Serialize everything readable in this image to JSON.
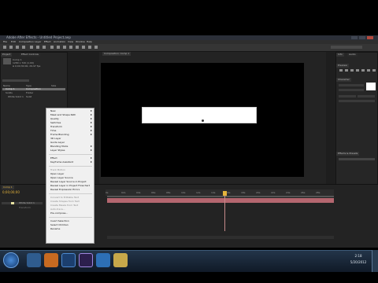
{
  "window": {
    "title": "Adobe After Effects - Untitled Project.aep",
    "controls": [
      "minimize",
      "maximize",
      "close"
    ]
  },
  "menubar": [
    "File",
    "Edit",
    "Composition",
    "Layer",
    "Effect",
    "Animation",
    "View",
    "Window",
    "Help"
  ],
  "panels": {
    "project_tab": "Project",
    "effect_controls_tab": "Effect Controls",
    "composition_tab": "Composition: Comp 1",
    "timeline_tab": "Comp 1",
    "info_tab": "Info",
    "audio_tab": "Audio",
    "preview_tab": "Preview",
    "effects_tab": "Effects & Presets",
    "character_tab": "Character",
    "paragraph_tab": "Paragraph"
  },
  "project": {
    "item_name": "Comp 1",
    "item_info": "1280 x 720 (1.00)",
    "item_duration": "Δ 0;00;30;00, 29.97 fps",
    "column_name": "Name",
    "column_type": "Type",
    "column_size": "Size",
    "rows": [
      {
        "name": "Comp 1",
        "type": "Composition"
      },
      {
        "name": "Solids",
        "type": "Folder"
      },
      {
        "name": "White Solid 1",
        "type": "Solid"
      }
    ],
    "bpc": "8 bpc"
  },
  "context_menu": {
    "items": [
      {
        "label": "New",
        "submenu": true,
        "disabled": false
      },
      {
        "label": "Mask and Shape Path",
        "submenu": true,
        "disabled": false
      },
      {
        "label": "Quality",
        "submenu": true,
        "disabled": false
      },
      {
        "label": "Switches",
        "submenu": true,
        "disabled": false
      },
      {
        "label": "Transform",
        "submenu": true,
        "disabled": false
      },
      {
        "label": "Time",
        "submenu": true,
        "disabled": false
      },
      {
        "label": "Frame Blending",
        "submenu": true,
        "disabled": false
      },
      {
        "label": "3D Layer",
        "submenu": false,
        "disabled": false
      },
      {
        "label": "Guide Layer",
        "submenu": false,
        "disabled": false
      },
      {
        "label": "Blending Mode",
        "submenu": true,
        "disabled": false
      },
      {
        "label": "Layer Styles",
        "submenu": true,
        "disabled": false
      },
      {
        "separator": true
      },
      {
        "label": "Effect",
        "submenu": true,
        "disabled": false
      },
      {
        "label": "Keyframe Assistant",
        "submenu": true,
        "disabled": false
      },
      {
        "separator": true
      },
      {
        "label": "Track Motion",
        "submenu": false,
        "disabled": true
      },
      {
        "label": "Open Layer",
        "submenu": false,
        "disabled": false
      },
      {
        "label": "Open Layer Source",
        "submenu": false,
        "disabled": false
      },
      {
        "label": "Reveal Layer Source in Project",
        "submenu": false,
        "disabled": false
      },
      {
        "label": "Reveal Layer in Project Flowchart",
        "submenu": false,
        "disabled": false
      },
      {
        "label": "Reveal Expression Errors",
        "submenu": false,
        "disabled": false
      },
      {
        "separator": true
      },
      {
        "label": "Convert to Editable Text",
        "submenu": false,
        "disabled": true
      },
      {
        "label": "Create Shapes from Text",
        "submenu": false,
        "disabled": true
      },
      {
        "label": "Create Masks from Text",
        "submenu": false,
        "disabled": true
      },
      {
        "label": "Auto-trace...",
        "submenu": false,
        "disabled": true
      },
      {
        "label": "Pre-compose...",
        "submenu": false,
        "disabled": false
      },
      {
        "separator": true
      },
      {
        "label": "Invert Selection",
        "submenu": false,
        "disabled": false
      },
      {
        "label": "Select Children",
        "submenu": false,
        "disabled": false
      },
      {
        "label": "Rename",
        "submenu": false,
        "disabled": false
      }
    ]
  },
  "timeline": {
    "timecode": "0;00;00;00",
    "ruler_ticks": [
      "0s",
      "02s",
      "04s",
      "06s",
      "08s",
      "10s",
      "12s",
      "14s",
      "16s",
      "18s",
      "20s",
      "22s",
      "24s",
      "26s",
      "28s"
    ],
    "layer_name": "White Solid 1",
    "layer_color": "#b4666f"
  },
  "preview": {
    "controls": [
      "first-frame",
      "prev-frame",
      "play",
      "next-frame",
      "last-frame",
      "audio",
      "loop",
      "ram-preview"
    ]
  },
  "taskbar": {
    "time": "2:18",
    "date": "5/20/2012",
    "pinned": [
      "explorer",
      "firefox",
      "photoshop",
      "after-effects",
      "media-player",
      "folder"
    ]
  },
  "colors": {
    "accent": "#e5b43c",
    "layer": "#b4666f",
    "panel_bg": "#262626"
  }
}
